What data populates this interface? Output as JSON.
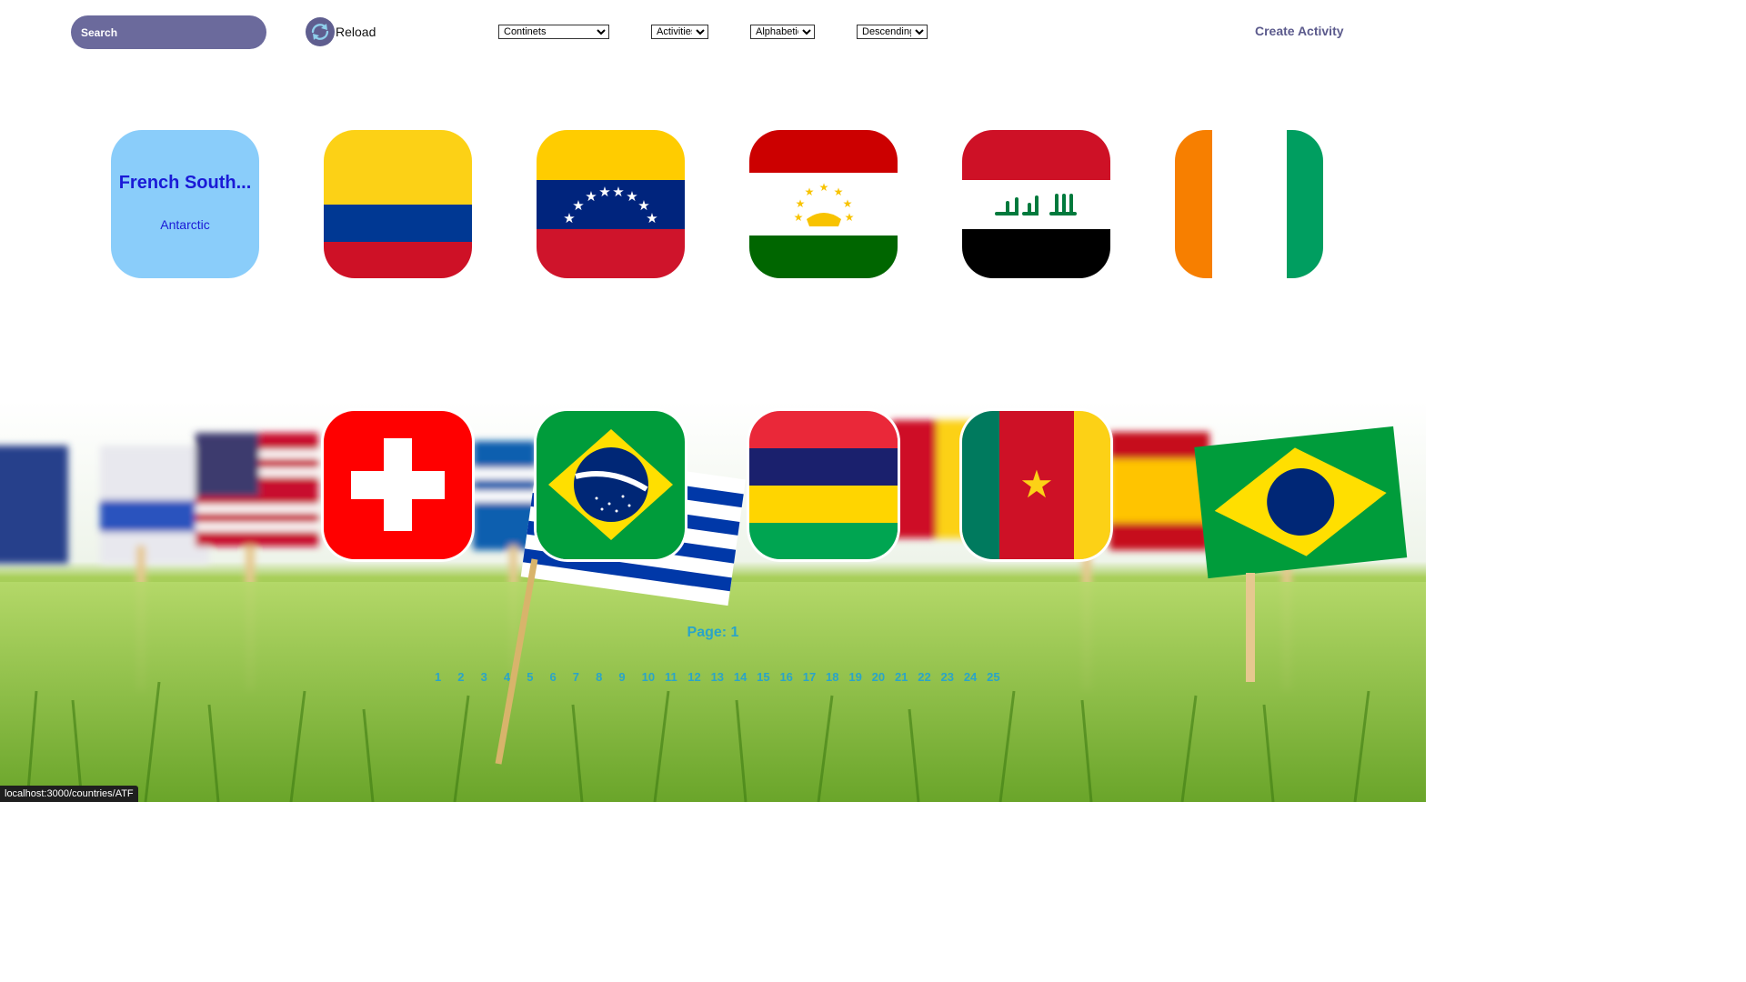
{
  "search": {
    "placeholder": "Search"
  },
  "reload": {
    "label": "Reload"
  },
  "filters": [
    {
      "name": "continent-filter",
      "value": "Continets",
      "options": [
        "Continets"
      ]
    },
    {
      "name": "activity-filter",
      "value": "Activities",
      "options": [
        "Activities"
      ]
    },
    {
      "name": "order-type",
      "value": "Alphabetic",
      "options": [
        "Alphabetic"
      ]
    },
    {
      "name": "order-direction",
      "value": "Descending",
      "options": [
        "Descending"
      ]
    }
  ],
  "nav": {
    "create_label": "Create Activity"
  },
  "cards": [
    {
      "type": "text",
      "name": "French South...",
      "continent": "Antarctic"
    },
    {
      "type": "flag",
      "flag": "colombia-flag"
    },
    {
      "type": "flag",
      "flag": "venezuela-flag"
    },
    {
      "type": "flag",
      "flag": "tajikistan-flag"
    },
    {
      "type": "flag",
      "flag": "iraq-flag"
    },
    {
      "type": "flag",
      "flag": "ivory-coast-flag"
    },
    {
      "type": "flag",
      "flag": "switzerland-flag"
    },
    {
      "type": "flag",
      "flag": "brazil-flag"
    },
    {
      "type": "flag",
      "flag": "mauritius-flag"
    },
    {
      "type": "flag",
      "flag": "cameroon-flag"
    }
  ],
  "pagination": {
    "label": "Page: 1",
    "pages": [
      "1",
      "2",
      "3",
      "4",
      "5",
      "6",
      "7",
      "8",
      "9",
      "10",
      "11",
      "12",
      "13",
      "14",
      "15",
      "16",
      "17",
      "18",
      "19",
      "20",
      "21",
      "22",
      "23",
      "24",
      "25"
    ]
  },
  "status_bar": {
    "url": "localhost:3000/countries/ATF"
  },
  "colors": {
    "accent": "#6b6a9c",
    "card_bg": "#8acdfa",
    "card_text": "#1a1ad6",
    "pager": "#2aa4c8"
  }
}
